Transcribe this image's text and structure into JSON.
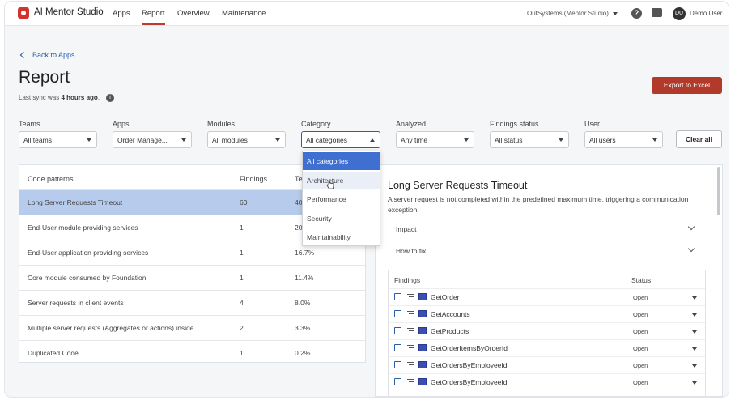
{
  "app": {
    "title": "AI Mentor Studio"
  },
  "nav": {
    "apps": "Apps",
    "report": "Report",
    "overview": "Overview",
    "maintenance": "Maintenance"
  },
  "tenant": "OutSystems (Mentor Studio)",
  "user": {
    "initials": "DU",
    "name": "Demo User"
  },
  "header": {
    "back": "Back to Apps",
    "title": "Report",
    "sync_prefix": "Last sync was ",
    "sync_bold": "4 hours ago",
    "sync_suffix": ".",
    "export": "Export to Excel"
  },
  "filters": [
    {
      "label": "Teams",
      "value": "All teams"
    },
    {
      "label": "Apps",
      "value": "Order Manage..."
    },
    {
      "label": "Modules",
      "value": "All modules"
    },
    {
      "label": "Category",
      "value": "All categories"
    },
    {
      "label": "Analyzed",
      "value": "Any time"
    },
    {
      "label": "Findings status",
      "value": "All status"
    },
    {
      "label": "User",
      "value": "All users"
    }
  ],
  "clear_all": "Clear all",
  "category_dropdown": [
    "All categories",
    "Architecture",
    "Performance",
    "Security",
    "Maintainability"
  ],
  "patterns_table": {
    "headers": [
      "Code patterns",
      "Findings",
      "Te"
    ],
    "rows": [
      {
        "name": "Long Server Requests Timeout",
        "findings": "60",
        "pct": "40"
      },
      {
        "name": "End-User module providing services",
        "findings": "1",
        "pct": "20"
      },
      {
        "name": "End-User application providing services",
        "findings": "1",
        "pct": "16.7%"
      },
      {
        "name": "Core module consumed by Foundation",
        "findings": "1",
        "pct": "11.4%"
      },
      {
        "name": "Server requests in client events",
        "findings": "4",
        "pct": "8.0%"
      },
      {
        "name": "Multiple server requests (Aggregates or actions) inside ...",
        "findings": "2",
        "pct": "3.3%"
      },
      {
        "name": "Duplicated Code",
        "findings": "1",
        "pct": "0.2%"
      }
    ]
  },
  "detail": {
    "title": "Long Server Requests Timeout",
    "description": "A server request is not completed within the predefined maximum time, triggering a communication exception.",
    "impact": "Impact",
    "how_to_fix": "How to fix",
    "findings_header": "Findings",
    "status_header": "Status",
    "findings": [
      {
        "name": "GetOrder",
        "status": "Open"
      },
      {
        "name": "GetAccounts",
        "status": "Open"
      },
      {
        "name": "GetProducts",
        "status": "Open"
      },
      {
        "name": "GetOrderItemsByOrderId",
        "status": "Open"
      },
      {
        "name": "GetOrdersByEmployeeId",
        "status": "Open"
      },
      {
        "name": "GetOrdersByEmployeeId",
        "status": "Open"
      }
    ]
  }
}
